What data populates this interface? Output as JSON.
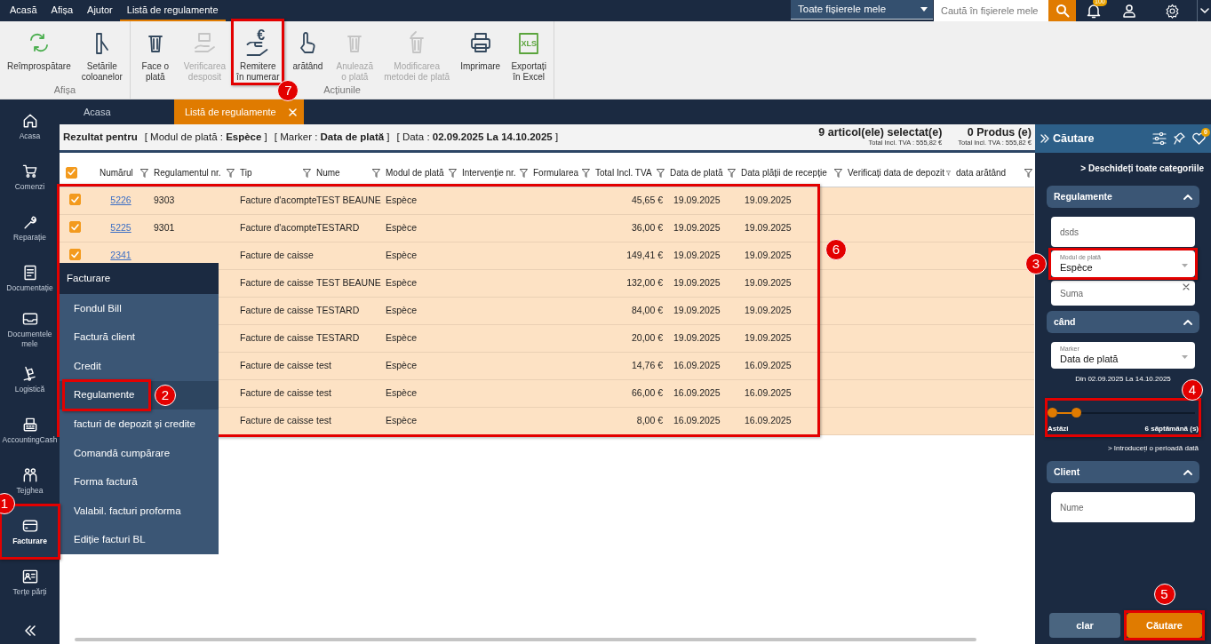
{
  "top_menu": [
    {
      "label": "Acasă",
      "selected": false
    },
    {
      "label": "Afișa",
      "selected": false
    },
    {
      "label": "Ajutor",
      "selected": false
    },
    {
      "label": "Listă de regulamente",
      "selected": true
    }
  ],
  "file_scope": {
    "value": "Toate fișierele mele"
  },
  "search": {
    "placeholder": "Caută în fișierele mele"
  },
  "notifications": {
    "badge": "100"
  },
  "ribbon": {
    "groups": [
      {
        "label": "Afișa",
        "buttons": [
          {
            "label": "Reîmprospătare",
            "kind": "refresh",
            "disabled": false
          },
          {
            "label": "Setările\ncoloanelor",
            "kind": "columns",
            "disabled": false
          }
        ]
      },
      {
        "label": "Acțiunile",
        "buttons": [
          {
            "label": "Face o\nplată",
            "kind": "pay",
            "disabled": false
          },
          {
            "label": "Verificarea\ndesposit",
            "kind": "deposit",
            "disabled": true
          },
          {
            "label": "Remitere\nîn numerar",
            "kind": "cash",
            "icon_text": "€",
            "disabled": false
          },
          {
            "label": "arătând",
            "kind": "pointer",
            "disabled": false
          },
          {
            "label": "Anulează\no plată",
            "kind": "pay",
            "disabled": true
          },
          {
            "label": "Modificarea\nmetodei de plată",
            "kind": "edit",
            "disabled": true
          },
          {
            "label": "Imprimare",
            "kind": "print",
            "disabled": false
          },
          {
            "label": "Exportați\nîn Excel",
            "kind": "excel",
            "icon_text": "XLS",
            "disabled": false
          }
        ]
      }
    ]
  },
  "doc_tabs": [
    {
      "label": "Acasa",
      "selected": false,
      "closable": false
    },
    {
      "label": "Listă de regulamente",
      "selected": true,
      "closable": true
    }
  ],
  "sidebar": {
    "items": [
      {
        "label": "Acasa",
        "kind": "home",
        "selected": false
      },
      {
        "label": "Comenzi",
        "kind": "cart",
        "selected": false
      },
      {
        "label": "Reparație",
        "kind": "wrench",
        "selected": false
      },
      {
        "label": "Documentație",
        "kind": "document",
        "selected": false
      },
      {
        "label": "Documentele\nmele",
        "kind": "inbox",
        "selected": false
      },
      {
        "label": "Logistică",
        "kind": "trolley",
        "selected": false
      },
      {
        "label": "AccountingCash",
        "kind": "register",
        "selected": false
      },
      {
        "label": "Tejghea",
        "kind": "people",
        "selected": false
      },
      {
        "label": "Facturare",
        "kind": "card",
        "selected": true
      },
      {
        "label": "Terțe părți",
        "kind": "contact",
        "selected": false
      }
    ]
  },
  "summary": {
    "heading": "Rezultat pentru",
    "filters": [
      "[ Modul de plată : **Espèce** ]",
      "[ Marker : **Data de plată** ]",
      "[ Data : **02.09.2025 La 14.10.2025** ]"
    ],
    "counters": [
      {
        "label": "9  articol(ele) selectat(e)",
        "total": "Total Incl. TVA : 555,82 €"
      },
      {
        "label": "0  Produs (e)",
        "total": "Total Incl. TVA : 555,82 €"
      }
    ]
  },
  "table": {
    "all_checked": true,
    "columns": [
      "Numărul",
      "Regulamentul nr.",
      "Tip",
      "Nume",
      "Modul de plată",
      "Intervenție nr.",
      "Formularea",
      "Total Incl. TVA",
      "Data de plată",
      "Data plății de recepție",
      "Verificați data de depozit",
      "data arătând"
    ],
    "rows": [
      {
        "checked": true,
        "number": "5226",
        "regulation_no": "9303",
        "type": "Facture d'acompte",
        "name": "TEST BEAUNE",
        "payment_mode": "Espèce",
        "total": "45,65 €",
        "payment_date": "19.09.2025",
        "receipt_date": "19.09.2025"
      },
      {
        "checked": true,
        "number": "5225",
        "regulation_no": "9301",
        "type": "Facture d'acompte",
        "name": "TESTARD",
        "payment_mode": "Espèce",
        "total": "36,00 €",
        "payment_date": "19.09.2025",
        "receipt_date": "19.09.2025"
      },
      {
        "checked": true,
        "number": "2341",
        "type": "Facture de caisse",
        "payment_mode": "Espèce",
        "total": "149,41 €",
        "payment_date": "19.09.2025",
        "receipt_date": "19.09.2025"
      },
      {
        "type": "Facture de caisse",
        "name": "TEST BEAUNE",
        "payment_mode": "Espèce",
        "total": "132,00 €",
        "payment_date": "19.09.2025",
        "receipt_date": "19.09.2025"
      },
      {
        "type": "Facture de caisse",
        "name": "TESTARD",
        "payment_mode": "Espèce",
        "total": "84,00 €",
        "payment_date": "19.09.2025",
        "receipt_date": "19.09.2025"
      },
      {
        "type": "Facture de caisse",
        "name": "TESTARD",
        "payment_mode": "Espèce",
        "total": "20,00 €",
        "payment_date": "19.09.2025",
        "receipt_date": "19.09.2025"
      },
      {
        "type": "Facture de caisse",
        "name": "test",
        "payment_mode": "Espèce",
        "total": "14,76 €",
        "payment_date": "16.09.2025",
        "receipt_date": "16.09.2025"
      },
      {
        "type": "Facture de caisse",
        "name": "test",
        "payment_mode": "Espèce",
        "total": "66,00 €",
        "payment_date": "16.09.2025",
        "receipt_date": "16.09.2025"
      },
      {
        "type": "Facture de caisse",
        "name": "test",
        "payment_mode": "Espèce",
        "total": "8,00 €",
        "payment_date": "16.09.2025",
        "receipt_date": "16.09.2025"
      }
    ]
  },
  "flyout_menu": {
    "title": "Facturare",
    "items": [
      {
        "label": "Fondul Bill",
        "selected": false
      },
      {
        "label": "Factură client",
        "selected": false
      },
      {
        "label": "Credit",
        "selected": false
      },
      {
        "label": "Regulamente",
        "selected": true
      },
      {
        "label": "facturi de depozit și credite",
        "selected": false
      },
      {
        "label": "Comandă cumpărare",
        "selected": false
      },
      {
        "label": "Forma factură",
        "selected": false
      },
      {
        "label": "Valabil. facturi proforma",
        "selected": false
      },
      {
        "label": "Ediție facturi BL",
        "selected": false
      }
    ]
  },
  "search_panel": {
    "title": "Căutare",
    "badge": "0",
    "expand_all": "> Deschideți toate categoriile",
    "sections": [
      {
        "title": "Regulamente",
        "expanded": true,
        "fields": [
          {
            "kind": "text",
            "placeholder": "dsds"
          },
          {
            "kind": "select",
            "label": "Modul de plată",
            "value": "Espèce"
          },
          {
            "kind": "text",
            "placeholder": "Suma",
            "clearable": true
          }
        ]
      },
      {
        "title": "când",
        "expanded": true,
        "fields": [
          {
            "kind": "select",
            "label": "Marker",
            "value": "Data de plată"
          },
          {
            "kind": "note",
            "text": "Din 02.09.2025 La 14.10.2025"
          },
          {
            "kind": "range",
            "level": 0.16,
            "min_label": "Astăzi",
            "max_label": "6 săptămână (s)"
          },
          {
            "kind": "link",
            "text": "> Introduceți o perioadă dată"
          }
        ]
      },
      {
        "title": "Client",
        "expanded": true,
        "fields": [
          {
            "kind": "text",
            "placeholder": "Nume"
          }
        ]
      }
    ],
    "buttons": [
      {
        "label": "clar",
        "kind": "secondary"
      },
      {
        "label": "Căutare",
        "kind": "primary"
      }
    ]
  },
  "annotations": [
    {
      "number": "1"
    },
    {
      "number": "2"
    },
    {
      "number": "3"
    },
    {
      "number": "4"
    },
    {
      "number": "5"
    },
    {
      "number": "6"
    },
    {
      "number": "7"
    }
  ]
}
